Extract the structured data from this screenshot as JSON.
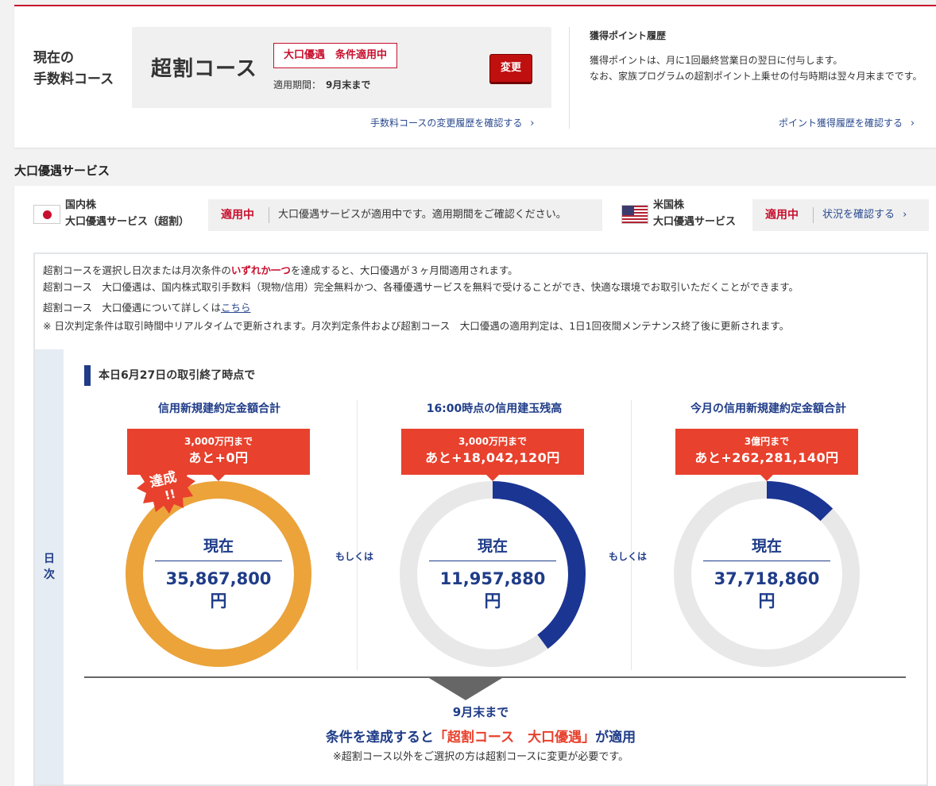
{
  "course": {
    "heading_line1": "現在の",
    "heading_line2": "手数料コース",
    "name": "超割コース",
    "tag": "大口優遇　条件適用中",
    "period_label": "適用期間：",
    "period_value": "9月末まで",
    "change_button": "変更",
    "history_link": "手数料コースの変更履歴を確認する"
  },
  "points": {
    "title": "獲得ポイント履歴",
    "text_line1": "獲得ポイントは、月に1回最終営業日の翌日に付与します。",
    "text_line2": "なお、家族プログラムの超割ポイント上乗せの付与時期は翌々月末までです。",
    "history_link": "ポイント獲得履歴を確認する"
  },
  "section_title": "大口優遇サービス",
  "domestic": {
    "market_line1": "国内株",
    "market_line2": "大口優遇サービス（超割）",
    "status": "適用中",
    "message": "大口優遇サービスが適用中です。適用期間をご確認ください。"
  },
  "us": {
    "market_line1": "米国株",
    "market_line2": "大口優遇サービス",
    "status": "適用中",
    "link": "状況を確認する"
  },
  "info": {
    "line1_pre": "超割コースを選択し日次または月次条件の",
    "line1_hl": "いずれか一つ",
    "line1_post": "を達成すると、大口優遇が３ヶ月間適用されます。",
    "line2": "超割コース　大口優遇は、国内株式取引手数料（現物/信用）完全無料かつ、各種優遇サービスを無料で受けることができ、快適な環境でお取引いただくことができます。",
    "line3_pre": "超割コース　大口優遇について詳しくは",
    "line3_link": "こちら",
    "line4": "※ 日次判定条件は取引時間中リアルタイムで更新されます。月次判定条件および超割コース　大口優遇の適用判定は、1日1回夜間メンテナンス終了後に更新されます。"
  },
  "daily": {
    "side_label_1": "日",
    "side_label_2": "次",
    "as_of": "本日6月27日の取引終了時点で",
    "or_label": "もしくは",
    "achieved_line1": "達成",
    "achieved_line2": "!!",
    "columns": [
      {
        "title": "信用新規建約定金額合計",
        "target_line1": "3,000万円まで",
        "target_line2": "あと+0円",
        "current_label": "現在",
        "current_value": "35,867,800",
        "unit": "円",
        "progress": 1.0,
        "color": "#eba33a"
      },
      {
        "title": "16:00時点の信用建玉残高",
        "target_line1": "3,000万円まで",
        "target_line2": "あと+18,042,120円",
        "current_label": "現在",
        "current_value": "11,957,880",
        "unit": "円",
        "progress": 0.3986,
        "color": "#1b3593"
      },
      {
        "title": "今月の信用新規建約定金額合計",
        "target_line1": "3億円まで",
        "target_line2": "あと+262,281,140円",
        "current_label": "現在",
        "current_value": "37,718,860",
        "unit": "円",
        "progress": 0.1257,
        "color": "#1b3593"
      }
    ],
    "cond_period": "9月末まで",
    "cond_pre": "条件を達成すると",
    "cond_red": "「超割コース　大口優遇」",
    "cond_post": "が適用",
    "cond_note": "※超割コース以外をご選択の方は超割コースに変更が必要です。"
  },
  "colors": {
    "brand_red": "#c8102e",
    "accent_red": "#e8412d",
    "navy": "#1f3c88",
    "achieved_orange": "#eba33a",
    "ring_track": "#e8e8e8"
  }
}
